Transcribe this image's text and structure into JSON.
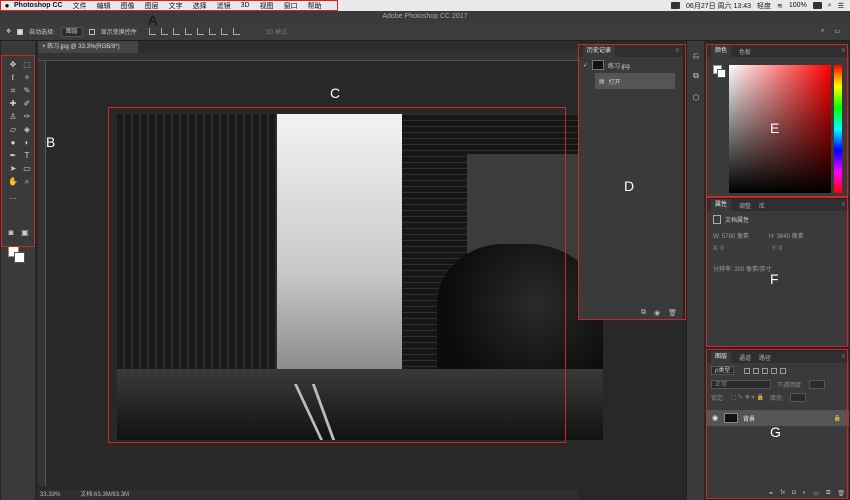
{
  "menubar": {
    "app": "Photoshop CC",
    "items": [
      "文件",
      "编辑",
      "图像",
      "图层",
      "文字",
      "选择",
      "滤镜",
      "3D",
      "视图",
      "窗口",
      "帮助"
    ],
    "datetime": "06月27日 周六 13:43",
    "user": "轻度",
    "battery": "100%"
  },
  "window": {
    "title": "Adobe Photoshop CC 2017"
  },
  "options": {
    "auto_select_label": "自动选择:",
    "auto_select_value": "图层",
    "show_transform_label": "显示变换控件",
    "mode3d_label": "3D 模式:"
  },
  "document": {
    "tab_label": "练习.jpg @ 33.3%(RGB/8*)"
  },
  "history_panel": {
    "tab": "历史记录",
    "items": [
      {
        "label": "练习.jpg"
      },
      {
        "label": "打开"
      }
    ]
  },
  "color_panel": {
    "tabs": [
      "颜色",
      "色板"
    ]
  },
  "properties_panel": {
    "tabs": [
      "属性",
      "调整",
      "库"
    ],
    "doc_label": "文档属性",
    "w": "W: 5760 像素",
    "h": "H: 3840 像素",
    "x": "X: 0",
    "y": "Y: 0",
    "resolution": "分辨率: 300 像素/英寸"
  },
  "layers_panel": {
    "tabs": [
      "图层",
      "通道",
      "路径"
    ],
    "filter_label": "ρ类型",
    "blend_mode": "正常",
    "opacity_label": "不透明度:",
    "lock_label": "锁定:",
    "fill_label": "填充:",
    "layer_name": "背景"
  },
  "status": {
    "zoom": "33.33%",
    "doc": "文档:63.3M/63.3M"
  },
  "annotations": {
    "A": "A",
    "B": "B",
    "C": "C",
    "D": "D",
    "E": "E",
    "F": "F",
    "G": "G"
  },
  "colors": {
    "annotation_red": "#d0262a",
    "ui_bg": "#282828",
    "panel_bg": "#3a3a3a"
  }
}
